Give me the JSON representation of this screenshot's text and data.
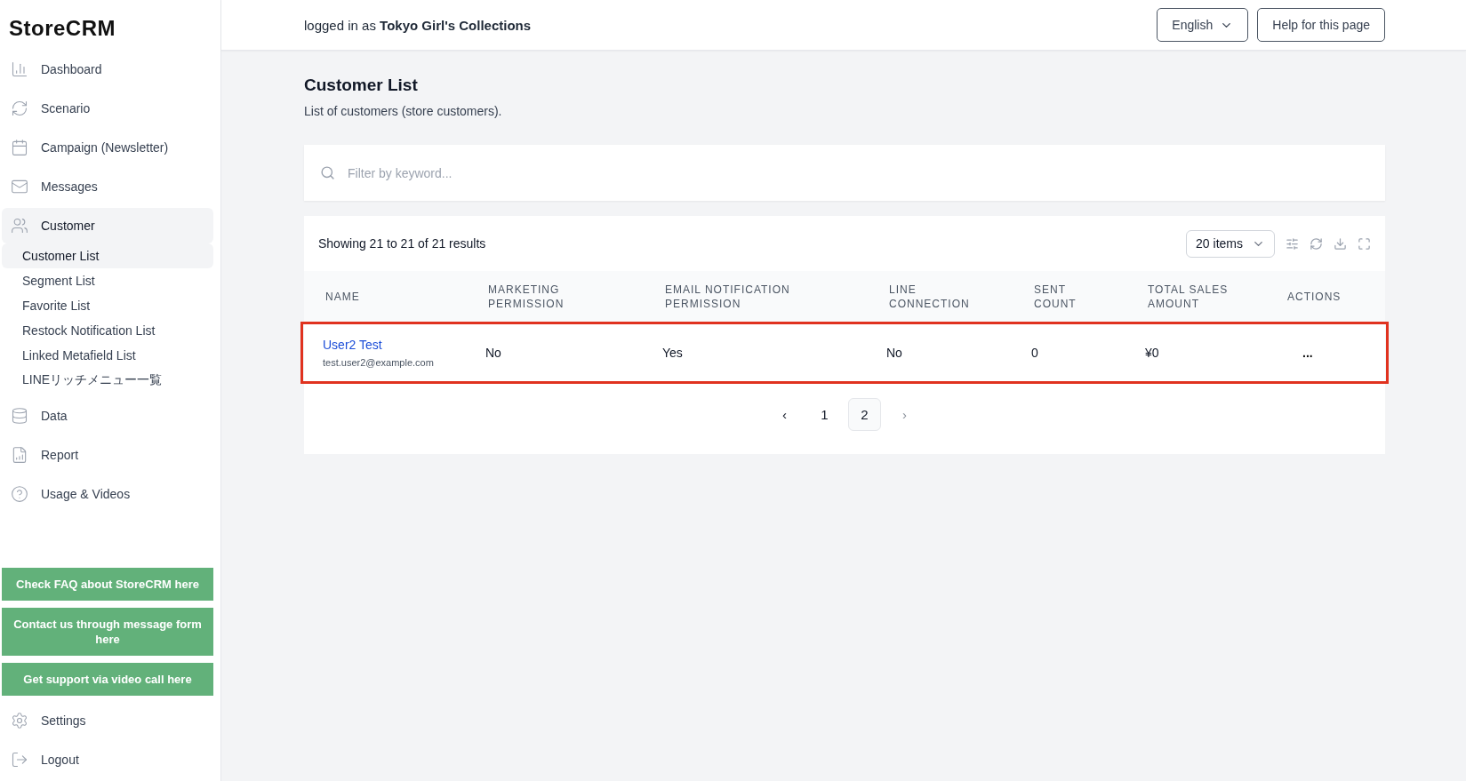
{
  "sidebar": {
    "logo": "StoreCRM",
    "nav": [
      {
        "label": "Dashboard",
        "selected": false
      },
      {
        "label": "Scenario",
        "selected": false
      },
      {
        "label": "Campaign (Newsletter)",
        "selected": false
      },
      {
        "label": "Messages",
        "selected": false
      },
      {
        "label": "Customer",
        "selected": true,
        "expanded": true,
        "children": [
          {
            "label": "Customer List",
            "selected": true
          },
          {
            "label": "Segment List",
            "selected": false
          },
          {
            "label": "Favorite List",
            "selected": false
          },
          {
            "label": "Restock Notification List",
            "selected": false
          },
          {
            "label": "Linked Metafield List",
            "selected": false
          },
          {
            "label": "LINEリッチメニュー一覧",
            "selected": false
          }
        ]
      },
      {
        "label": "Data",
        "selected": false
      },
      {
        "label": "Report",
        "selected": false
      },
      {
        "label": "Usage & Videos",
        "selected": false
      }
    ],
    "support_buttons": [
      "Check FAQ about StoreCRM here",
      "Contact us through message form here",
      "Get support via video call here"
    ],
    "footer_nav": [
      {
        "label": "Settings"
      },
      {
        "label": "Logout"
      }
    ]
  },
  "header": {
    "login_prefix": "logged in as",
    "store_name": "Tokyo Girl's Collections",
    "language": "English",
    "help_button": "Help for this page"
  },
  "page": {
    "title": "Customer List",
    "subtitle": "List of customers (store customers)."
  },
  "search": {
    "placeholder": "Filter by keyword..."
  },
  "table": {
    "summary": "Showing 21 to 21 of 21 results",
    "page_size": "20 items",
    "columns": [
      "NAME",
      "MARKETING PERMISSION",
      "EMAIL NOTIFICATION PERMISSION",
      "LINE CONNECTION",
      "SENT COUNT",
      "TOTAL SALES AMOUNT",
      "ACTIONS"
    ],
    "rows": [
      {
        "name": "User2 Test",
        "email": "test.user2@example.com",
        "marketing": "No",
        "email_notification": "Yes",
        "line": "No",
        "sent_count": "0",
        "total_sales": "¥0",
        "actions": "...",
        "highlighted": true
      }
    ]
  },
  "pagination": {
    "prev": "‹",
    "next": "›",
    "pages": [
      {
        "label": "1",
        "selected": false
      },
      {
        "label": "2",
        "selected": true
      }
    ]
  }
}
